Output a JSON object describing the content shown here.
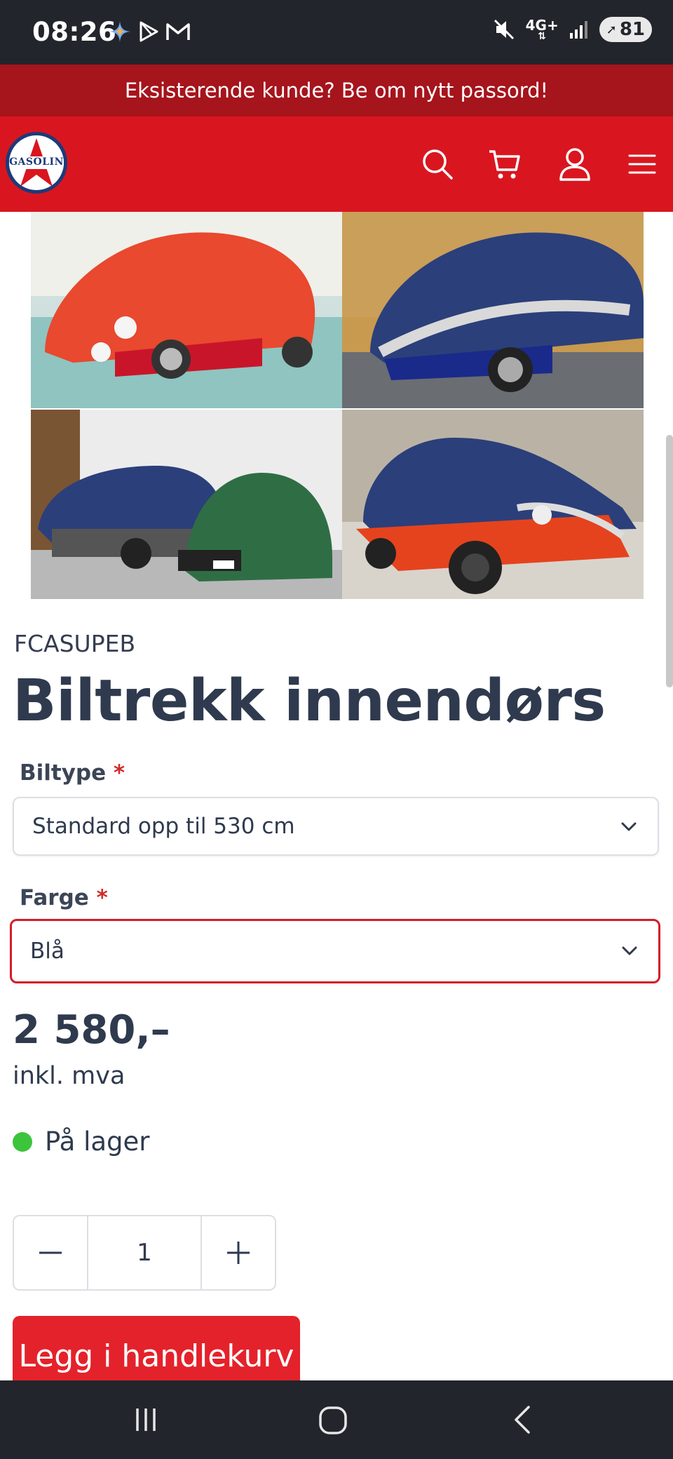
{
  "status_bar": {
    "time": "08:26",
    "network": "4G+",
    "battery": "81"
  },
  "notice": {
    "text": "Eksisterende kunde? Be om nytt passord!"
  },
  "header": {
    "logo_text": "GASOLIN",
    "icons": [
      "search-icon",
      "cart-icon",
      "user-icon",
      "menu-icon"
    ],
    "brand_color": "#d9161f"
  },
  "product": {
    "sku": "FCASUPEB",
    "title": "Biltrekk innendørs",
    "options": [
      {
        "label": "Biltype",
        "required_mark": "*",
        "value": "Standard opp til 530 cm"
      },
      {
        "label": "Farge",
        "required_mark": "*",
        "value": "Blå"
      }
    ],
    "price": "2 580,–",
    "vat_note": "inkl. mva",
    "stock_status": "På lager",
    "stock_color": "#3cc43c",
    "quantity": "1",
    "add_to_cart": "Legg i handlekurv"
  },
  "nav_bar": {
    "icons": [
      "recent-apps-icon",
      "home-icon",
      "back-icon"
    ]
  }
}
